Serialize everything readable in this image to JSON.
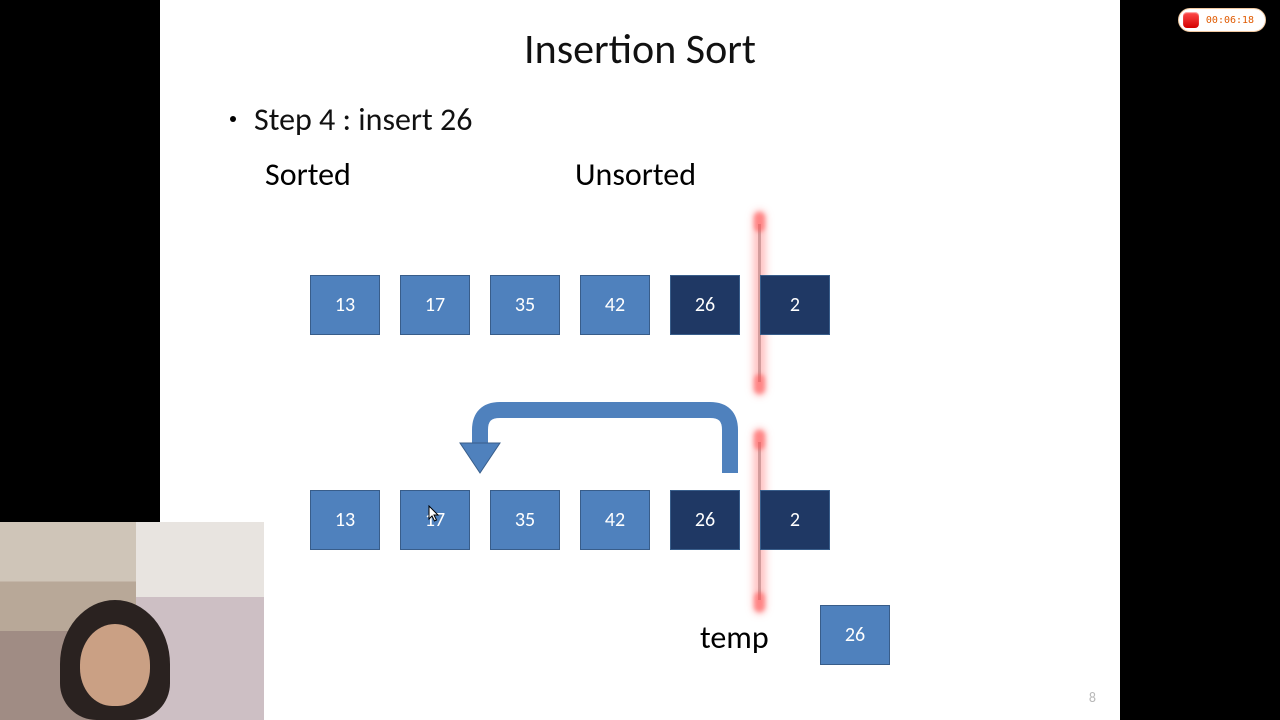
{
  "title": "Insertion Sort",
  "step_text": "Step 4 : insert 26",
  "labels": {
    "sorted": "Sorted",
    "unsorted": "Unsorted",
    "temp": "temp"
  },
  "row1": [
    {
      "v": "13",
      "tone": "light"
    },
    {
      "v": "17",
      "tone": "light"
    },
    {
      "v": "35",
      "tone": "light"
    },
    {
      "v": "42",
      "tone": "light"
    },
    {
      "v": "26",
      "tone": "dark"
    },
    {
      "v": "2",
      "tone": "dark"
    }
  ],
  "row2": [
    {
      "v": "13",
      "tone": "light"
    },
    {
      "v": "17",
      "tone": "light"
    },
    {
      "v": "35",
      "tone": "light"
    },
    {
      "v": "42",
      "tone": "light"
    },
    {
      "v": "26",
      "tone": "dark"
    },
    {
      "v": "2",
      "tone": "dark"
    }
  ],
  "temp_value": "26",
  "page_number": "8",
  "recorder_time": "00:06:18",
  "colors": {
    "light_fill": "#4f81bd",
    "dark_fill": "#1f3864",
    "arrow": "#4f81bd"
  }
}
